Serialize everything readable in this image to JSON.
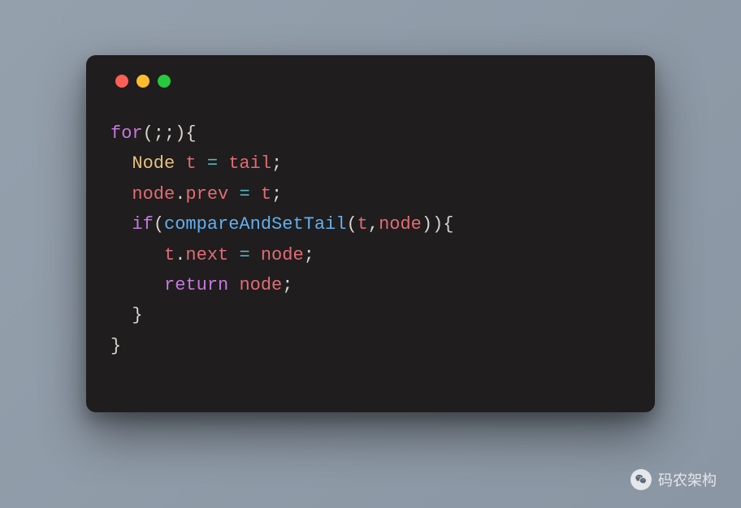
{
  "window": {
    "traffic_lights": [
      "red",
      "yellow",
      "green"
    ]
  },
  "code": {
    "lines": [
      [
        {
          "cls": "tok-kw",
          "text": "for"
        },
        {
          "cls": "tok-punct",
          "text": "(;;){"
        }
      ],
      [
        {
          "cls": "",
          "text": "  "
        },
        {
          "cls": "tok-type",
          "text": "Node"
        },
        {
          "cls": "",
          "text": " "
        },
        {
          "cls": "tok-ident",
          "text": "t"
        },
        {
          "cls": "",
          "text": " "
        },
        {
          "cls": "tok-op",
          "text": "="
        },
        {
          "cls": "",
          "text": " "
        },
        {
          "cls": "tok-ident",
          "text": "tail"
        },
        {
          "cls": "tok-punct",
          "text": ";"
        }
      ],
      [
        {
          "cls": "",
          "text": "  "
        },
        {
          "cls": "tok-ident",
          "text": "node"
        },
        {
          "cls": "tok-punct",
          "text": "."
        },
        {
          "cls": "tok-prop",
          "text": "prev"
        },
        {
          "cls": "",
          "text": " "
        },
        {
          "cls": "tok-op",
          "text": "="
        },
        {
          "cls": "",
          "text": " "
        },
        {
          "cls": "tok-ident",
          "text": "t"
        },
        {
          "cls": "tok-punct",
          "text": ";"
        }
      ],
      [
        {
          "cls": "",
          "text": "  "
        },
        {
          "cls": "tok-kw",
          "text": "if"
        },
        {
          "cls": "tok-punct",
          "text": "("
        },
        {
          "cls": "tok-call",
          "text": "compareAndSetTail"
        },
        {
          "cls": "tok-punct",
          "text": "("
        },
        {
          "cls": "tok-ident",
          "text": "t"
        },
        {
          "cls": "tok-punct",
          "text": ","
        },
        {
          "cls": "tok-ident",
          "text": "node"
        },
        {
          "cls": "tok-punct",
          "text": ")){"
        }
      ],
      [
        {
          "cls": "",
          "text": "     "
        },
        {
          "cls": "tok-ident",
          "text": "t"
        },
        {
          "cls": "tok-punct",
          "text": "."
        },
        {
          "cls": "tok-prop",
          "text": "next"
        },
        {
          "cls": "",
          "text": " "
        },
        {
          "cls": "tok-op",
          "text": "="
        },
        {
          "cls": "",
          "text": " "
        },
        {
          "cls": "tok-ident",
          "text": "node"
        },
        {
          "cls": "tok-punct",
          "text": ";"
        }
      ],
      [
        {
          "cls": "",
          "text": "     "
        },
        {
          "cls": "tok-kw",
          "text": "return"
        },
        {
          "cls": "",
          "text": " "
        },
        {
          "cls": "tok-ident",
          "text": "node"
        },
        {
          "cls": "tok-punct",
          "text": ";"
        }
      ],
      [
        {
          "cls": "",
          "text": "  "
        },
        {
          "cls": "tok-punct",
          "text": "}"
        }
      ],
      [
        {
          "cls": "tok-punct",
          "text": "}"
        }
      ]
    ]
  },
  "watermark": {
    "text": "码农架构",
    "icon": "wechat-icon"
  }
}
